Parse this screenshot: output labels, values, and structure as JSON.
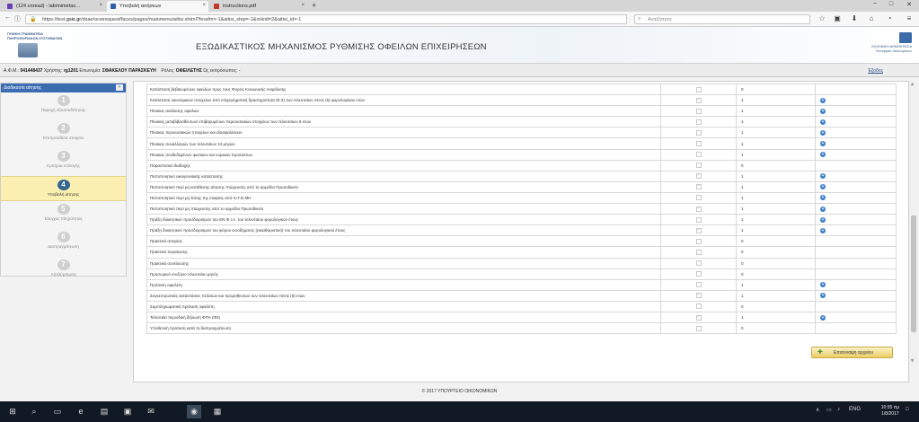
{
  "browser": {
    "tabs": [
      {
        "title": "(124 unread) - labrinimetas…",
        "favicon_color": "#6a3fb5"
      },
      {
        "title": "Υποβολή αιτήσεων",
        "favicon_color": "#2b5fa8"
      },
      {
        "title": "instructions.pdf",
        "favicon_color": "#c0392b"
      }
    ],
    "close_glyph": "×",
    "newtab_glyph": "+",
    "url_prefix": "https://test.",
    "url_host": "gsis.gr",
    "url_rest": "/dsae/ocwrequest/faces/pages/mainmenu/aitisi.xhtml?ferafm=-1&aitisi_step=-1&roleid=2&aitisi_id=-1",
    "search_placeholder": "Αναζήτηση",
    "nav_back": "←",
    "nav_info": "ⓘ",
    "lock": "🔒",
    "toolbar_icons": [
      "☆",
      "▣",
      "⬇",
      "⌂",
      "◔",
      "≡"
    ],
    "window_controls": [
      "−",
      "□",
      "✕"
    ]
  },
  "header": {
    "left_org_line1": "ΓΕΝΙΚΗ ΓΡΑΜΜΑΤΕΙΑ",
    "left_org_line2": "ΠΛΗΡΟΦΟΡΙΑΚΩΝ ΣΥΣΤΗΜΑΤΩΝ",
    "title": "ΕΞΩΔΙΚΑΣΤΙΚΟΣ ΜΗΧΑΝΙΣΜΟΣ ΡΥΘΜΙΣΗΣ ΟΦΕΙΛΩΝ ΕΠΙΧΕΙΡΗΣΕΩΝ",
    "right_org_line1": "ΕΛΛΗΝΙΚΗ ΔΗΜΟΚΡΑΤΙΑ",
    "right_org_line2": "Υπουργείο Οικονομικών"
  },
  "userinfo": {
    "afm_label": "Α.Φ.Μ.:",
    "afm": "041448437",
    "user_label": "Χρήστης:",
    "user": "rg1201",
    "name_label": "Επωνυμία:",
    "name": "ΣΦΑΚΕΛΟΥ ΠΑΡΑΣΚΕΥΗ",
    "role_label": "Ρόλος:",
    "role": "ΟΦΕΙΛΕΤΗΣ",
    "proxy_label": "Ως εκπρόσωπος:",
    "proxy": "-",
    "logout": "Έξοδος"
  },
  "sidebar": {
    "title": "Διαδικασία αίτησης",
    "collapse_glyph": "«",
    "steps": [
      {
        "num": "1",
        "label": "Παροχή εξουσιοδότησης"
      },
      {
        "num": "2",
        "label": "Επιπρόσθετα στοιχεία"
      },
      {
        "num": "3",
        "label": "Κριτήρια επιλογής"
      },
      {
        "num": "4",
        "label": "Υποβολή αίτησης",
        "active": true
      },
      {
        "num": "5",
        "label": "Έλεγχος πληρότητας"
      },
      {
        "num": "6",
        "label": "Διαπραγμάτευση"
      },
      {
        "num": "7",
        "label": "Απολύμπωση"
      }
    ]
  },
  "documents": [
    {
      "title": "Κατάσταση βεβαιωμένων οφειλών προς τους Φορείς Κοινωνικής Ασφάλισης",
      "checked": false,
      "count": "0",
      "add": false
    },
    {
      "title": "Κατάσταση οικονομικών στοιχείων από επιχειρηματική δραστηριότητα (Ε.3) των τελευταίων πέντε (5) φορολογικών ετών",
      "checked": true,
      "count": "1",
      "add": true
    },
    {
      "title": "Πίνακας ανάλυσης οφειλών",
      "checked": false,
      "count": "1",
      "add": true
    },
    {
      "title": "Πίνακας μεταβιβασθέντων/ επιβαρυμένων περιουσιακών στοιχείων των τελευταίων 5 ετών",
      "checked": false,
      "count": "1",
      "add": true
    },
    {
      "title": "Πίνακας περιουσιακών στοιχείων και εξασφαλίσεων",
      "checked": false,
      "count": "1",
      "add": true
    },
    {
      "title": "Πίνακας συναλλαγών των τελευταίων 24 μηνών",
      "checked": false,
      "count": "1",
      "add": true
    },
    {
      "title": "Πίνακας συνδεδεμένων φυσικών και νομικών προσώπων",
      "checked": false,
      "count": "1",
      "add": true
    },
    {
      "title": "Παραστατικό διαδοχής",
      "checked": false,
      "count": "0",
      "add": false
    },
    {
      "title": "Πιστοποιητικό οικογενειακής κατάστασης",
      "checked": true,
      "count": "1",
      "add": true
    },
    {
      "title": "Πιστοποιητικό περί μη κατάθεσης αίτησης πτώχευσης από το αρμόδιο Πρωτοδικείο",
      "checked": true,
      "count": "1",
      "add": true
    },
    {
      "title": "Πιστοποιητικό περί μη λύσης της εταιρίας από το Γ.Ε.ΜΗ",
      "checked": false,
      "count": "1",
      "add": true
    },
    {
      "title": "Πιστοποιητικό περί μη πτώχευσης από το αρμόδιο Πρωτοδικείο",
      "checked": true,
      "count": "1",
      "add": true
    },
    {
      "title": "Πράξη διοικητικού προσδιορισμού του ΕΝ.Φ.Ι.Α. του τελευταίου φορολογικού έτους",
      "checked": false,
      "count": "1",
      "add": true
    },
    {
      "title": "Πράξη διοικητικού προσδιορισμού του φόρου εισοδήματος (εκκαθαριστικό) του τελευταίου φορολογικού έτους",
      "checked": true,
      "count": "1",
      "add": true
    },
    {
      "title": "Πρακτικό απορίας",
      "checked": false,
      "count": "0",
      "add": false
    },
    {
      "title": "Πρακτικό περαίωσης",
      "checked": false,
      "count": "0",
      "add": false
    },
    {
      "title": "Πρακτικό συνέλευσης",
      "checked": false,
      "count": "0",
      "add": false
    },
    {
      "title": "Προσωρινό ισοζύγιο τελευταίου μηνός",
      "checked": false,
      "count": "0",
      "add": false
    },
    {
      "title": "Πρόταση οφειλέτη",
      "checked": false,
      "count": "1",
      "add": true
    },
    {
      "title": "Συγκεντρωτικές καταστάσεις πελατών και προμηθευτών των τελευταίων πέντε (5) ετών",
      "checked": true,
      "count": "1",
      "add": true
    },
    {
      "title": "Συμπληρωματική πρόταση οφειλέτη",
      "checked": false,
      "count": "0",
      "add": false
    },
    {
      "title": "Τελευταία περιοδική δήλωση ΦΠΑ (Φ2)",
      "checked": true,
      "count": "1",
      "add": true
    },
    {
      "title": "Υποθετική πρόταση κατά τη διαπραγμάτευση",
      "checked": false,
      "count": "0",
      "add": false
    }
  ],
  "actions": {
    "add_glyph": "+",
    "submit_label": "Επισύναψη αρχείου",
    "submit_icon": "✚"
  },
  "footer": {
    "text": "© 2017 ΥΠΟΥΡΓΕΙΟ ΟΙΚΟΝΟΜΙΚΩΝ"
  },
  "taskbar": {
    "apps": [
      {
        "name": "start-icon",
        "glyph": "⊞"
      },
      {
        "name": "search-icon",
        "glyph": "⌕"
      },
      {
        "name": "task-view-icon",
        "glyph": "▭"
      },
      {
        "name": "edge-icon",
        "glyph": "e"
      },
      {
        "name": "file-explorer-icon",
        "glyph": "▤"
      },
      {
        "name": "store-icon",
        "glyph": "▣"
      },
      {
        "name": "mail-icon",
        "glyph": "✉"
      },
      {
        "name": "firefox-icon",
        "glyph": "◉"
      },
      {
        "name": "app-icon",
        "glyph": "▦"
      }
    ],
    "tray_icons": [
      "∧",
      "▭",
      "♪"
    ],
    "language": "ENG",
    "time": "10:55 πμ",
    "date": "1/8/2017",
    "notification_glyph": "□"
  },
  "colors": {
    "sidebar_header": "#3b6cb1",
    "active_step_bg": "#fbf0b1",
    "active_step_num": "#34658f",
    "add_button": "#3a7dc9",
    "submit_button": "#eccd62"
  }
}
